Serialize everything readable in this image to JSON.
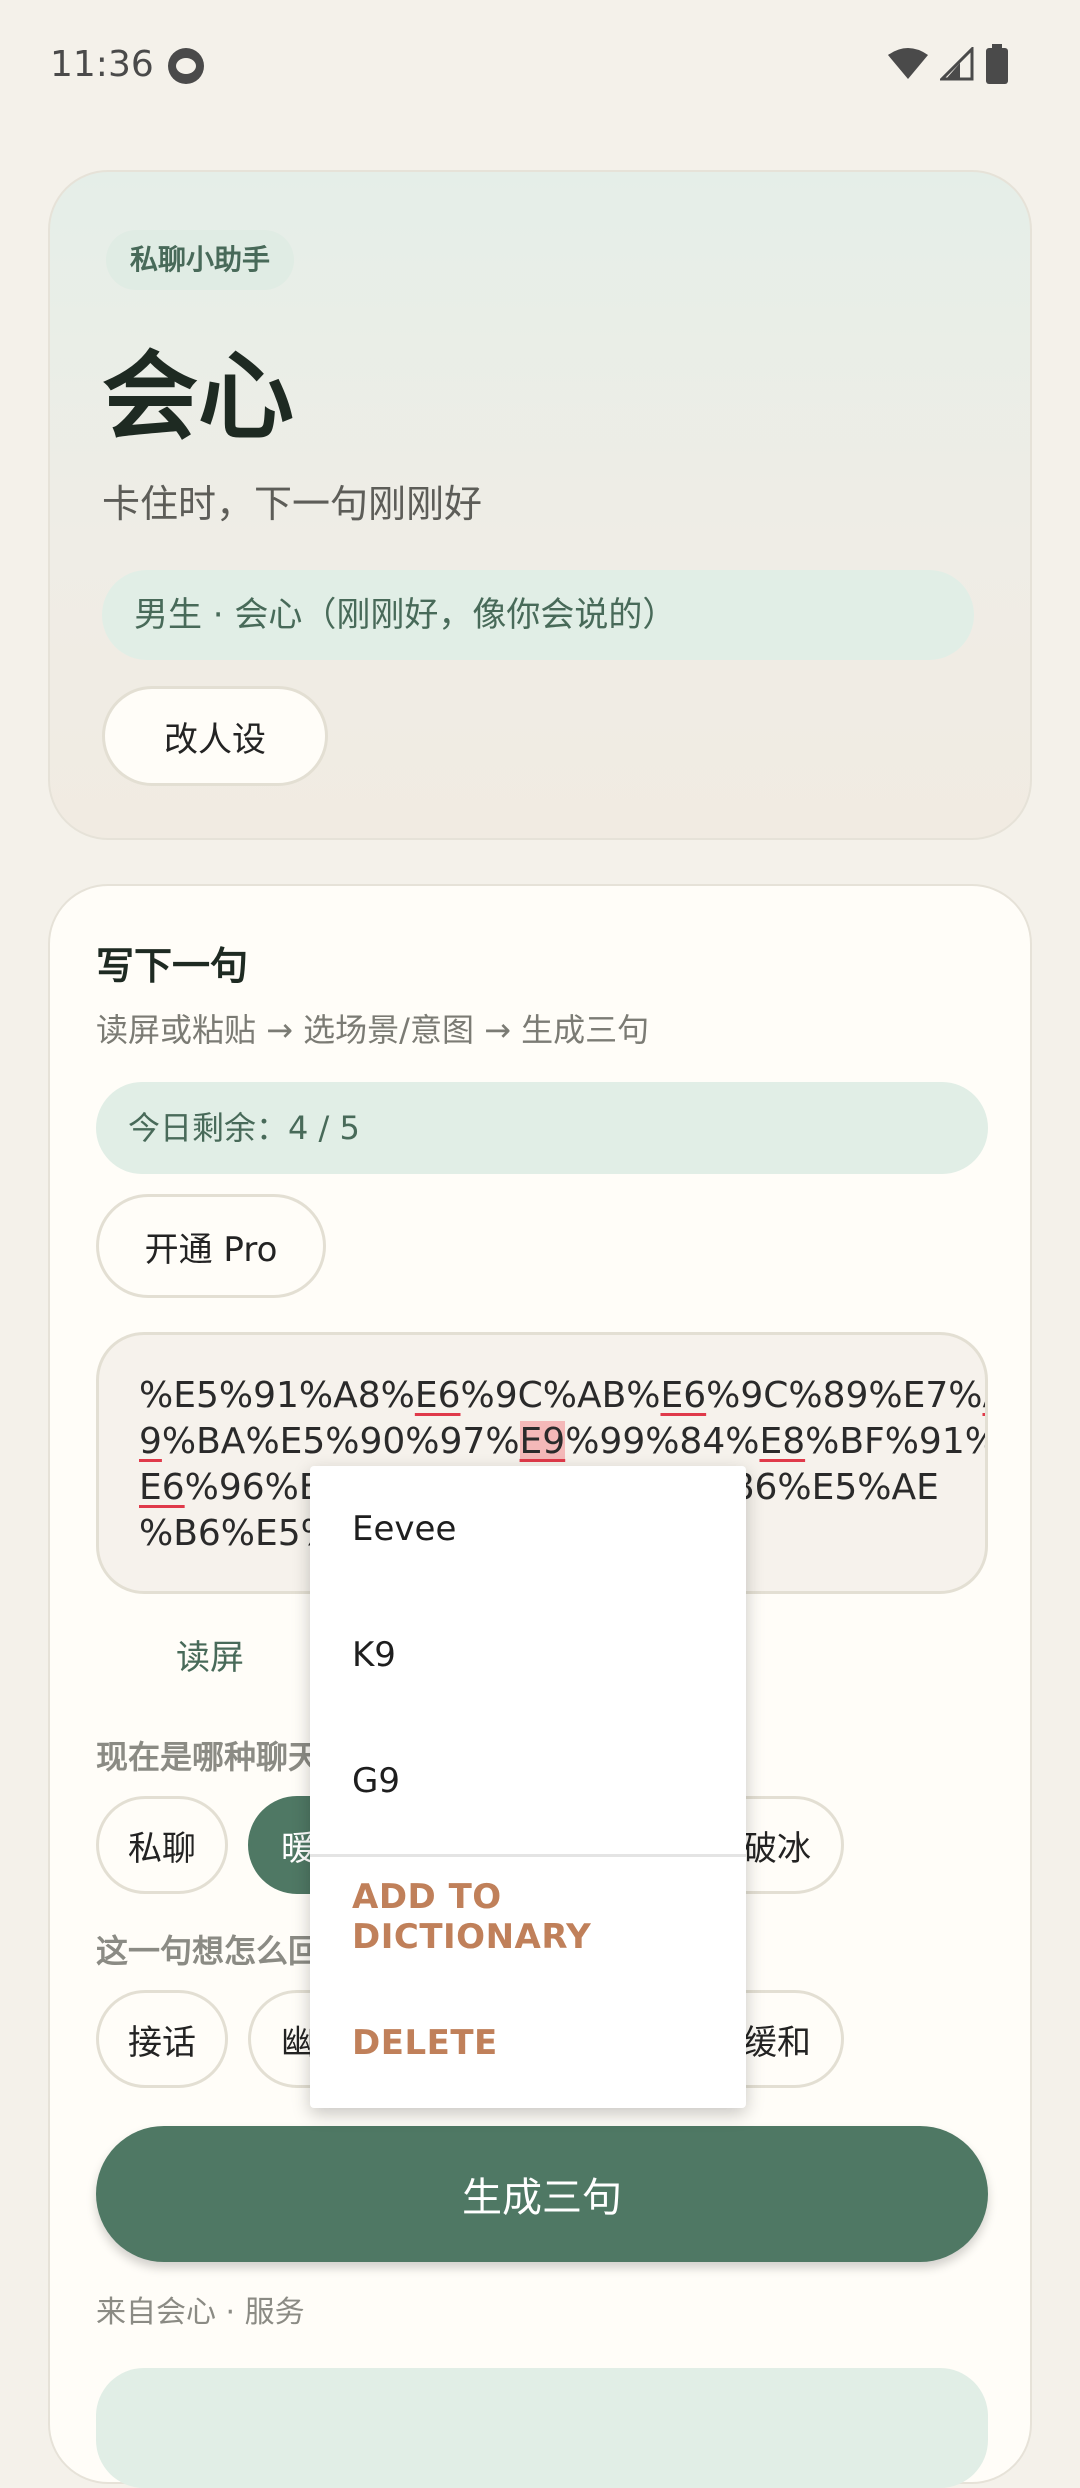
{
  "status": {
    "time": "11:36"
  },
  "hero": {
    "tag": "私聊小助手",
    "title": "会心",
    "subtitle": "卡住时，下一句刚刚好",
    "persona": "男生 · 会心（刚刚好，像你会说的）",
    "edit_persona_label": "改人设"
  },
  "composer": {
    "title": "写下一句",
    "steps": "读屏或粘贴 → 选场景/意图 → 生成三句",
    "quota": "今日剩余：4 / 5",
    "pro_label": "开通 Pro",
    "input_lines": {
      "l1_a": "%E5%91%A8%",
      "l1_b": "E6",
      "l1_c": "%9C%AB%",
      "l1_d": "E6",
      "l1_e": "%9C%89%E7%",
      "l1_f": "A",
      "l2_a": "9",
      "l2_b": "%BA%E5%90%97%",
      "l2_c": "E9",
      "l2_d": "%99%84%",
      "l2_e": "E8",
      "l2_f": "%BF%91%",
      "l3_a": "E6",
      "l3_b": "%96%B",
      "l3_c": "86%E5%AE",
      "l4_a": "%B6%E5%"
    },
    "read_screen_label": "读屏",
    "scene_label": "现在是哪种聊天",
    "scene_chips": [
      "私聊",
      "暖",
      "破冰"
    ],
    "intent_label": "这一句想怎么回",
    "intent_chips": [
      "接话",
      "幽",
      "缓和"
    ],
    "generate_label": "生成三句",
    "source_label": "来自会心 · 服务"
  },
  "popup": {
    "suggestions": [
      "Eevee",
      "K9",
      "G9"
    ],
    "add_to_dictionary": "ADD TO DICTIONARY",
    "delete": "DELETE"
  },
  "colors": {
    "accent": "#4f7864",
    "accent_light": "#e1eee6",
    "action": "#c0805a"
  }
}
